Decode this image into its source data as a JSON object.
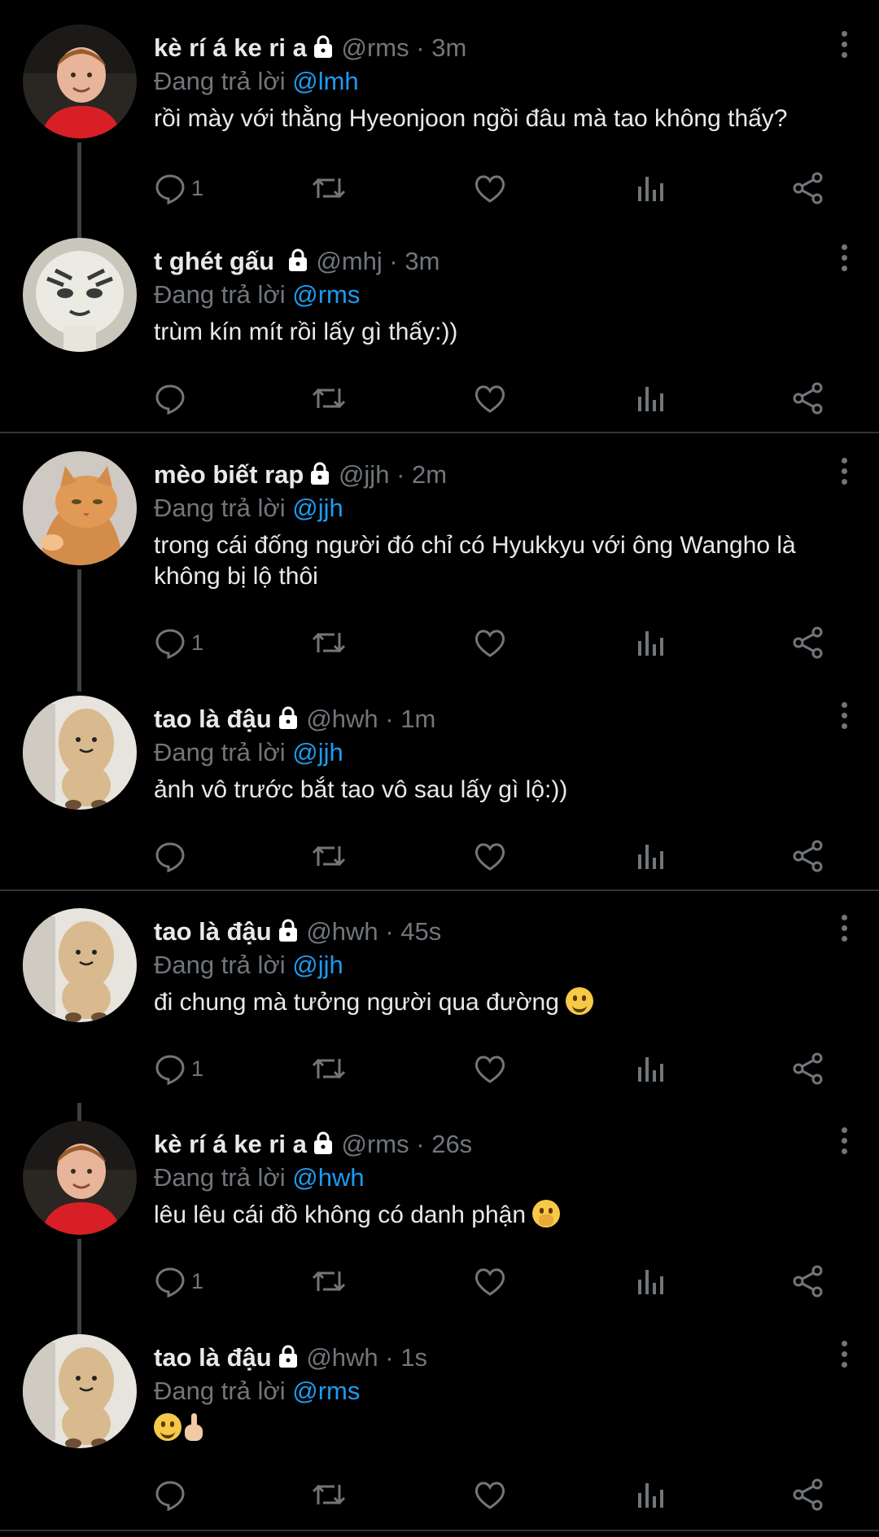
{
  "reply_prefix": "Đang trả lời",
  "colors": {
    "background": "#000000",
    "text": "#e7e9ea",
    "muted": "#71767b",
    "accent": "#1d9bf0",
    "divider": "#2f3336"
  },
  "avatars": {
    "rms": "child in red shirt",
    "mhj": "tiger plush",
    "jjh": "orange cat",
    "hwh": "peanut plush"
  },
  "tweets": [
    {
      "name": "kè rí á ke ri a",
      "handle": "@rms",
      "dot": "·",
      "time": "3m",
      "reply_to": "@lmh",
      "text": "rồi mày với thằng Hyeonjoon ngồi đâu mà tao không thấy?",
      "reply_count": "1"
    },
    {
      "name": "t ghét gấu",
      "handle": "@mhj",
      "dot": "·",
      "time": "3m",
      "reply_to": "@rms",
      "text": "trùm kín mít rồi lấy gì thấy:))",
      "reply_count": ""
    },
    {
      "name": "mèo biết rap",
      "handle": "@jjh",
      "dot": "·",
      "time": "2m",
      "reply_to": "@jjh",
      "text": "trong cái đống người đó chỉ có Hyukkyu với ông Wangho là không bị lộ thôi",
      "reply_count": "1"
    },
    {
      "name": "tao là đậu",
      "handle": "@hwh",
      "dot": "·",
      "time": "1m",
      "reply_to": "@jjh",
      "text": "ảnh vô trước bắt tao vô sau lấy gì lộ:))",
      "reply_count": ""
    },
    {
      "name": "tao là đậu",
      "handle": "@hwh",
      "dot": "·",
      "time": "45s",
      "reply_to": "@jjh",
      "text": "đi chung mà tưởng người qua đường",
      "emoji": "grinning-face",
      "reply_count": "1"
    },
    {
      "name": "kè rí á ke ri a",
      "handle": "@rms",
      "dot": "·",
      "time": "26s",
      "reply_to": "@hwh",
      "text": "lêu lêu cái đồ không có danh phận",
      "emoji": "face-with-hand-over-mouth",
      "reply_count": "1"
    },
    {
      "name": "tao là đậu",
      "handle": "@hwh",
      "dot": "·",
      "time": "1s",
      "reply_to": "@rms",
      "text": "",
      "emoji": "grinning-face + middle-finger",
      "reply_count": ""
    }
  ],
  "action_icons": [
    "reply-icon",
    "retweet-icon",
    "like-icon",
    "views-icon",
    "share-icon"
  ]
}
